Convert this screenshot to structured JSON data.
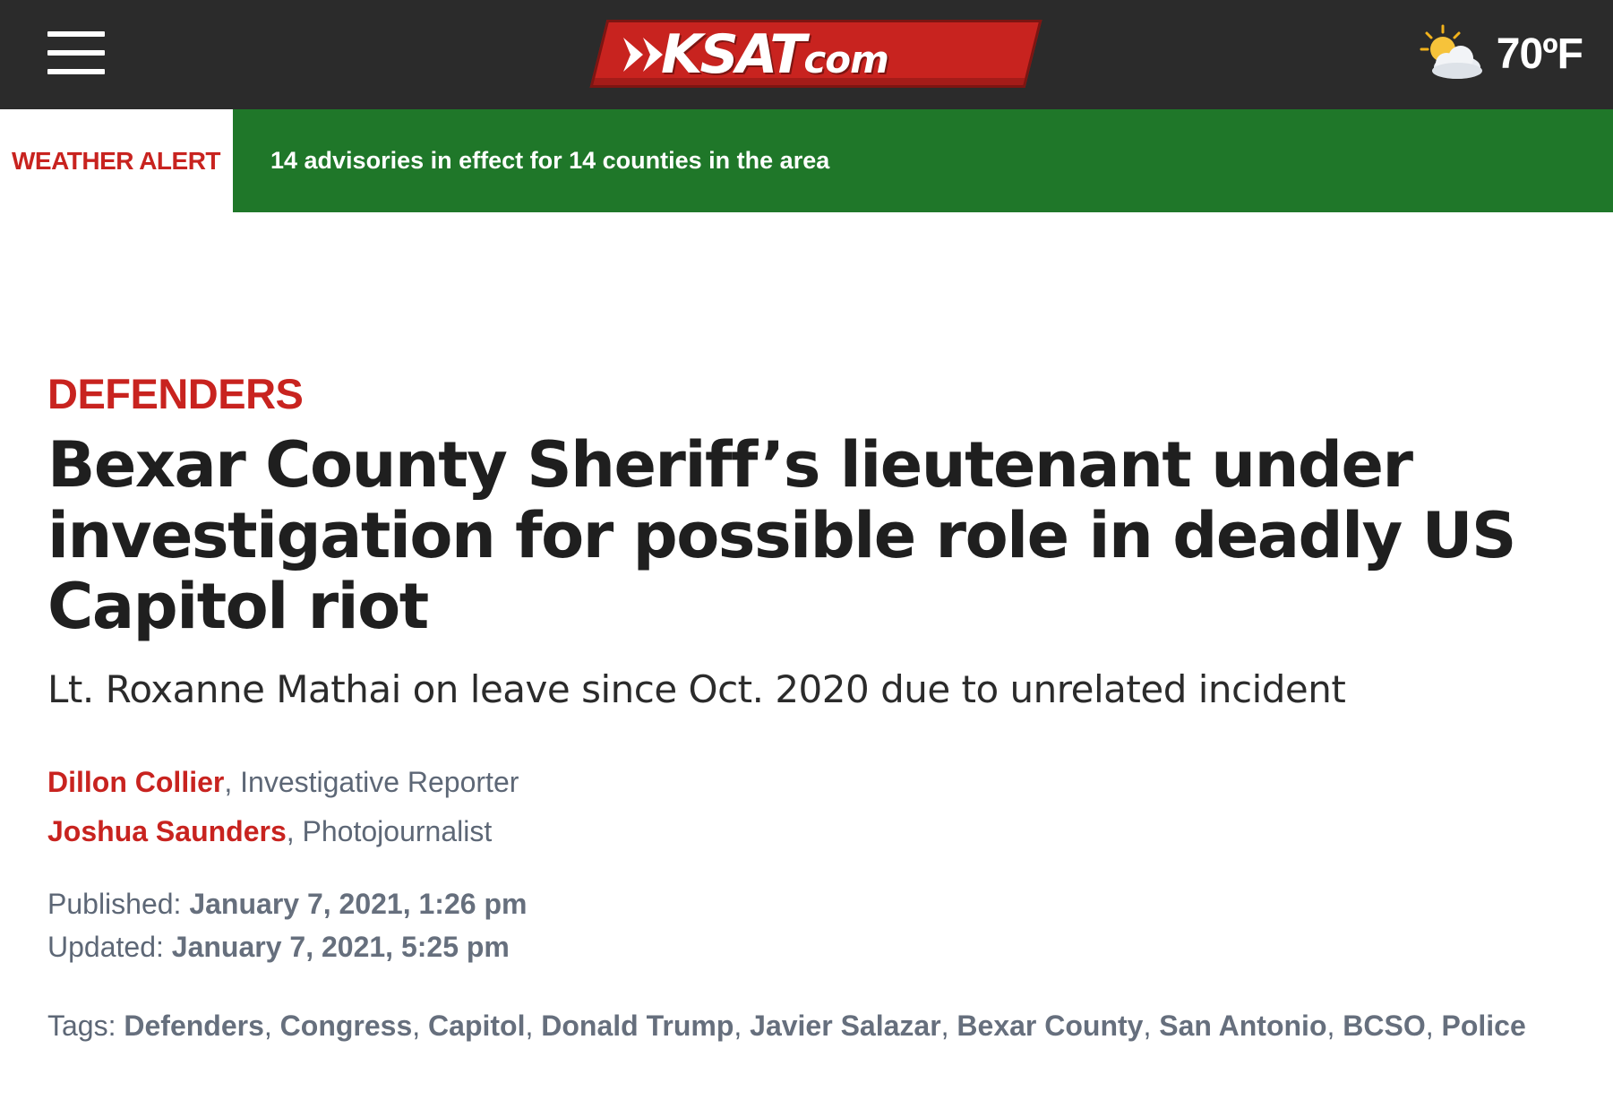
{
  "header": {
    "menu_icon": "hamburger-menu-icon",
    "logo_text": "KSAT",
    "logo_suffix": "com",
    "weather_icon": "partly-sunny-icon",
    "temperature": "70ºF",
    "colors": {
      "bar_bg": "#2b2b2b",
      "logo_red": "#c8231f"
    }
  },
  "alert": {
    "label": "WEATHER ALERT",
    "message": "14 advisories in effect for 14 counties in the area",
    "colors": {
      "label_text": "#c8231f",
      "message_bg": "#1f7729"
    }
  },
  "article": {
    "section": "DEFENDERS",
    "headline": "Bexar County Sheriff’s lieutenant under investigation for possible role in deadly US Capitol riot",
    "subheadline": "Lt. Roxanne Mathai on leave since Oct. 2020 due to unrelated incident",
    "authors": [
      {
        "name": "Dillon Collier",
        "role": ", Investigative Reporter"
      },
      {
        "name": "Joshua Saunders",
        "role": ", Photojournalist"
      }
    ],
    "published_label": "Published: ",
    "published_value": "January 7, 2021, 1:26 pm",
    "updated_label": "Updated: ",
    "updated_value": "January 7, 2021, 5:25 pm",
    "tags_label": "Tags: ",
    "tags": [
      "Defenders",
      "Congress",
      "Capitol",
      "Donald Trump",
      "Javier Salazar",
      "Bexar County",
      "San Antonio",
      "BCSO",
      "Police"
    ],
    "tag_separator": ", "
  }
}
